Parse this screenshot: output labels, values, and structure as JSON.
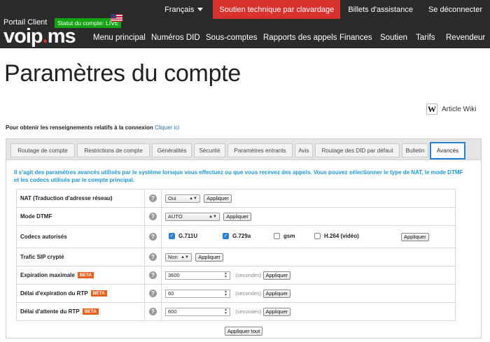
{
  "header": {
    "language": "Français",
    "support_chat": "Soutien technique par clavardage",
    "tickets": "Billets d'assistance",
    "logout": "Se déconnecter",
    "portal_label": "Portail Client",
    "logo_text_1": "voip",
    "logo_dot": ".",
    "logo_text_2": "ms",
    "account_status": "Statut du compte: LIVE",
    "nav": [
      "Menu principal",
      "Numéros DID",
      "Sous-comptes",
      "Rapports des appels",
      "Finances",
      "Soutien",
      "Tarifs",
      "Revendeur"
    ]
  },
  "page": {
    "title": "Paramètres du compte",
    "wiki_label": "Article Wiki",
    "connection_info": "Pour obtenir les renseignements relatifs à la connexion",
    "connection_link": "Cliquer ici"
  },
  "tabs": [
    "Routage de compte",
    "Restrictions de compte",
    "Généralités",
    "Sécurité",
    "Paramètres entrants",
    "Avis",
    "Routage des DID par défaut",
    "Bulletin",
    "Avancés"
  ],
  "active_tab": "Avancés",
  "intro": "Il s'agit des paramètres avancés utilisés par le système lorsque vous effectuez ou que vous recevez des appels. Vous pouvez sélectionner le type de NAT, le mode DTMF et les codecs utilisés par le compte principal.",
  "settings": {
    "nat": {
      "label": "NAT (Traduction d'adresse réseau)",
      "value": "Oui"
    },
    "dtmf": {
      "label": "Mode DTMF",
      "value": "AUTO"
    },
    "codecs": {
      "label": "Codecs autorisés",
      "items": [
        {
          "name": "G.711U",
          "checked": true
        },
        {
          "name": "G.729a",
          "checked": true
        },
        {
          "name": "gsm",
          "checked": false
        },
        {
          "name": "H.264 (vidéo)",
          "checked": false
        }
      ]
    },
    "sip_encrypt": {
      "label": "Trafic SIP crypté",
      "value": "Non"
    },
    "max_expiry": {
      "label": "Expiration maximale",
      "value": "3600"
    },
    "rtp_expiry": {
      "label": "Délai d'expiration du RTP",
      "value": "60"
    },
    "rtp_hold": {
      "label": "Délai d'attente du RTP",
      "value": "600"
    },
    "beta": "BETA",
    "unit": "(secondes)",
    "apply": "Appliquer",
    "apply_all": "Appliquer tout",
    "help": "?"
  }
}
